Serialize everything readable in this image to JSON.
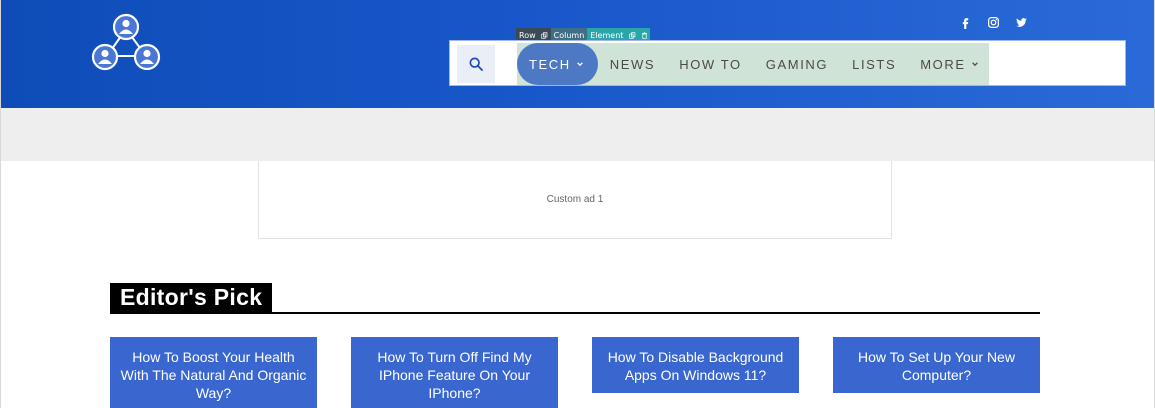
{
  "colors": {
    "header_start": "#0e4db8",
    "header_end": "#2a6ad8",
    "nav_active": "#4d78c4",
    "nav_highlight": "#cfe3d6",
    "card_bg": "#3a66d0"
  },
  "header": {
    "logo_icon": "people-network-icon",
    "social": [
      {
        "name": "facebook-icon"
      },
      {
        "name": "instagram-icon"
      },
      {
        "name": "twitter-icon"
      }
    ]
  },
  "editor_toolbar": {
    "row_label": "Row",
    "column_label": "Column",
    "element_label": "Element"
  },
  "nav": {
    "search_icon": "search-icon",
    "items": [
      {
        "label": "TECH",
        "dropdown": true,
        "active": true
      },
      {
        "label": "NEWS"
      },
      {
        "label": "HOW TO"
      },
      {
        "label": "GAMING"
      },
      {
        "label": "LISTS"
      },
      {
        "label": "MORE",
        "dropdown": true
      }
    ]
  },
  "ad": {
    "text": "Custom ad 1"
  },
  "editors_pick": {
    "heading": "Editor's Pick",
    "cards": [
      {
        "title": "How To Boost Your Health With The Natural And Organic Way?"
      },
      {
        "title": "How To Turn Off Find My IPhone Feature On Your IPhone?"
      },
      {
        "title": "How To Disable Background Apps On Windows 11?"
      },
      {
        "title": "How To Set Up Your New Computer?"
      }
    ]
  }
}
